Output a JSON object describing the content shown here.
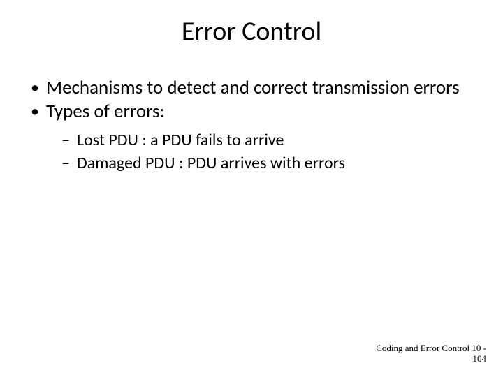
{
  "title": "Error Control",
  "bullets": {
    "b1": "Mechanisms to detect and correct transmission errors",
    "b2": "Types of errors:",
    "sub1": "Lost PDU : a PDU fails to arrive",
    "sub2": "Damaged PDU : PDU arrives with errors"
  },
  "footer": {
    "line1": "Coding and Error Control 10 -",
    "line2": "104"
  }
}
